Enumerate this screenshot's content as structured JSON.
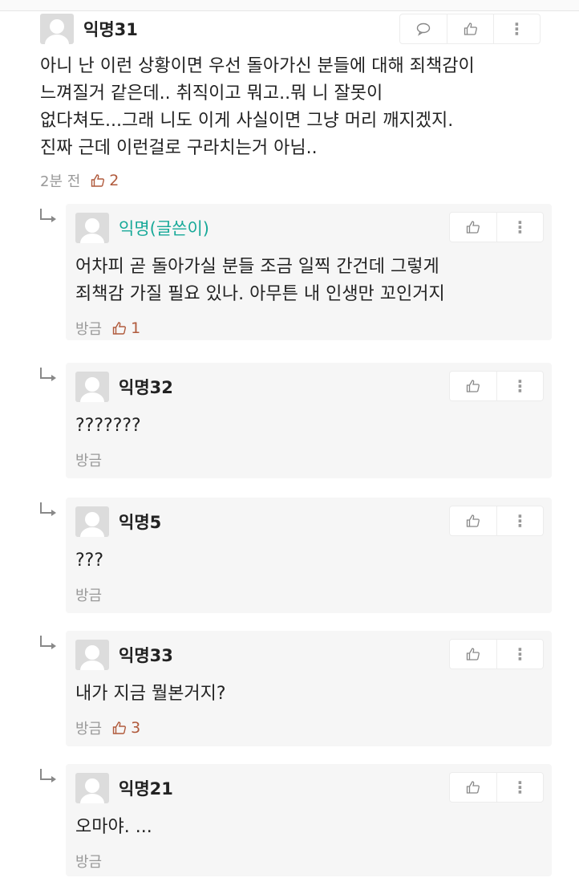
{
  "main_comment": {
    "nickname": "익명31",
    "text_lines": [
      "아니 난 이런 상황이면 우선 돌아가신 분들에 대해 죄책감이",
      "느껴질거 같은데.. 취직이고 뭐고..뭐 니 잘못이",
      "없다쳐도...그래 니도 이게 사실이면 그냥 머리 깨지겠지.",
      "진짜 근데 이런걸로 구라치는거 아님.."
    ],
    "time": "2분 전",
    "likes": "2",
    "more_icon": "⋮"
  },
  "replies": [
    {
      "nickname": "익명(글쓴이)",
      "text_lines": [
        "어차피 곧 돌아가실 분들 조금 일찍 간건데 그렇게",
        "죄책감 가질 필요 있나. 아무튼 내 인생만 꼬인거지"
      ],
      "time": "방금",
      "likes": "1",
      "more_icon": "⋮"
    },
    {
      "nickname": "익명32",
      "text_lines": [
        "???????"
      ],
      "time": "방금",
      "likes": "",
      "more_icon": "⋮"
    },
    {
      "nickname": "익명5",
      "text_lines": [
        "???"
      ],
      "time": "방금",
      "likes": "",
      "more_icon": "⋮"
    },
    {
      "nickname": "익명33",
      "text_lines": [
        "내가 지금 뭘본거지?"
      ],
      "time": "방금",
      "likes": "3",
      "more_icon": "⋮"
    },
    {
      "nickname": "익명21",
      "text_lines": [
        "오마야. ..."
      ],
      "time": "방금",
      "likes": "",
      "more_icon": "⋮"
    }
  ],
  "colors": {
    "author_nick": "#18a999",
    "like_accent": "#b05a3c",
    "reply_bg": "#f6f6f6"
  }
}
